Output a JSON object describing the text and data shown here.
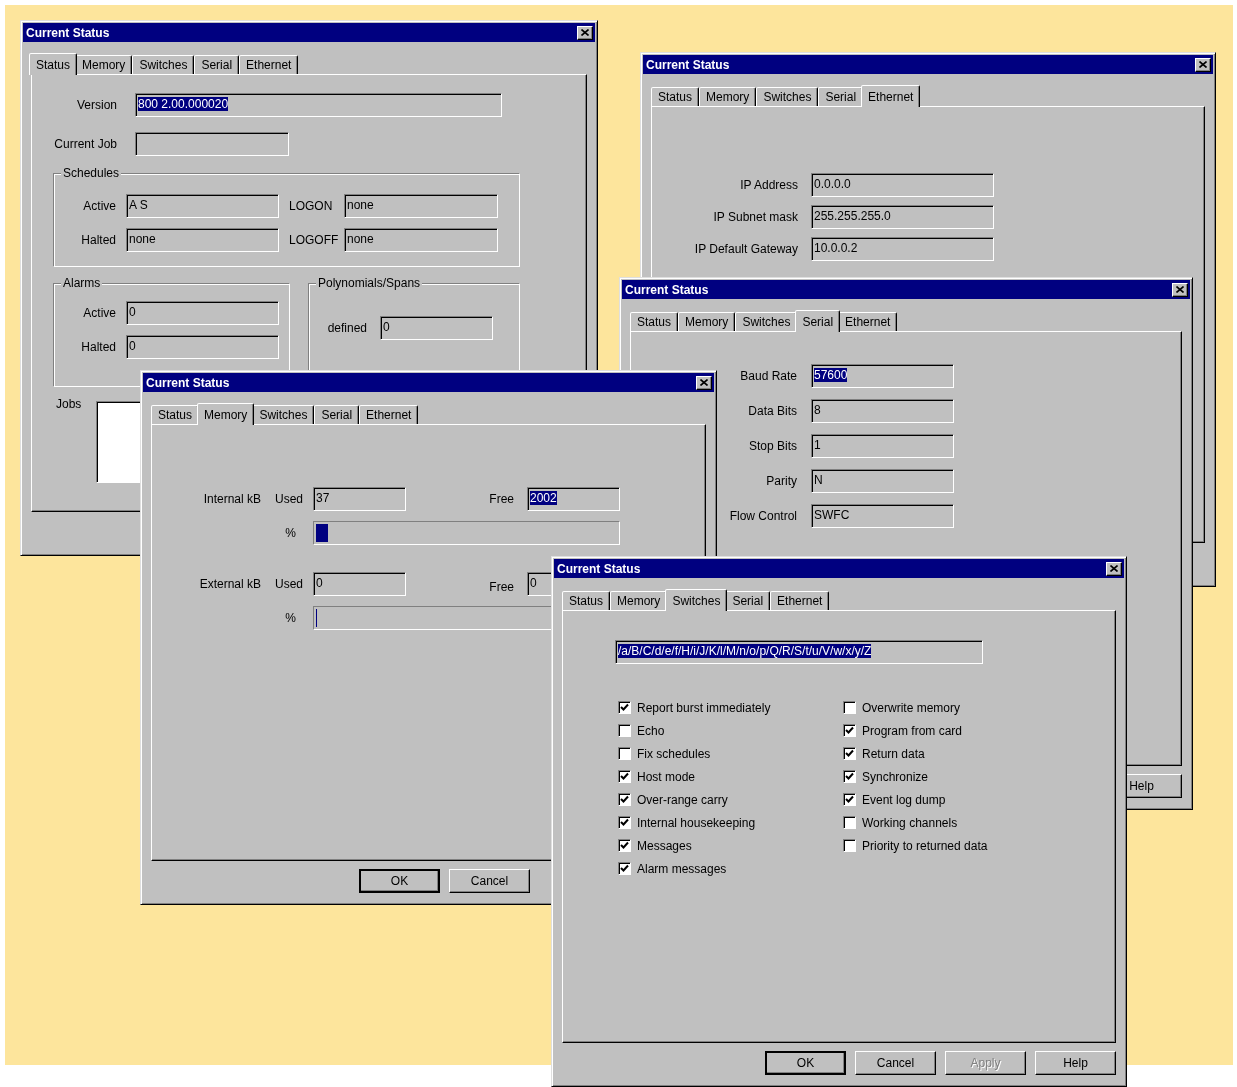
{
  "desktop": {
    "windows": [
      {
        "kind": "status",
        "title": "Current Status",
        "tabs": [
          {
            "label": "Status",
            "selected": true
          },
          {
            "label": "Memory",
            "selected": false
          },
          {
            "label": "Switches",
            "selected": false
          },
          {
            "label": "Serial",
            "selected": false
          },
          {
            "label": "Ethernet",
            "selected": false
          }
        ],
        "version": {
          "label": "Version",
          "value": "800 2.00.000020",
          "highlighted": true
        },
        "current_job": {
          "label": "Current Job"
        },
        "schedules": {
          "title": "Schedules",
          "fields": [
            {
              "label": "Active",
              "value": "A S",
              "highlighted": false
            },
            {
              "label": "LOGON",
              "value": "none",
              "highlighted": false
            },
            {
              "label": "Halted",
              "value": "none",
              "highlighted": false
            },
            {
              "label": "LOGOFF",
              "value": "none",
              "highlighted": false
            }
          ]
        },
        "alarms": {
          "title": "Alarms",
          "fields": [
            {
              "label": "Active",
              "value": "0",
              "highlighted": false
            },
            {
              "label": "Halted",
              "value": "0",
              "highlighted": false
            }
          ]
        },
        "polynomials": {
          "title": "Polynomials/Spans",
          "fields": [
            {
              "label": "defined",
              "value": "0",
              "highlighted": false
            }
          ]
        },
        "jobs": {
          "label": "Jobs"
        }
      },
      {
        "kind": "ethernet",
        "title": "Current Status",
        "tabs": [
          {
            "label": "Status",
            "selected": false
          },
          {
            "label": "Memory",
            "selected": false
          },
          {
            "label": "Switches",
            "selected": false
          },
          {
            "label": "Serial",
            "selected": false
          },
          {
            "label": "Ethernet",
            "selected": true
          }
        ],
        "fields": [
          {
            "label": "IP Address",
            "value": "0.0.0.0",
            "highlighted": false
          },
          {
            "label": "IP Subnet mask",
            "value": "255.255.255.0",
            "highlighted": false
          },
          {
            "label": "IP Default Gateway",
            "value": "10.0.0.2",
            "highlighted": false
          }
        ]
      },
      {
        "kind": "serial",
        "title": "Current Status",
        "tabs": [
          {
            "label": "Status",
            "selected": false
          },
          {
            "label": "Memory",
            "selected": false
          },
          {
            "label": "Switches",
            "selected": false
          },
          {
            "label": "Serial",
            "selected": true
          },
          {
            "label": "Ethernet",
            "selected": false
          }
        ],
        "fields": [
          {
            "label": "Baud Rate",
            "value": "57600",
            "highlighted": true
          },
          {
            "label": "Data Bits",
            "value": "8",
            "highlighted": false
          },
          {
            "label": "Stop Bits",
            "value": "1",
            "highlighted": false
          },
          {
            "label": "Parity",
            "value": "N",
            "highlighted": false
          },
          {
            "label": "Flow Control",
            "value": "SWFC",
            "highlighted": false
          }
        ],
        "buttons": [
          {
            "label": "Help",
            "disabled": false,
            "default": false
          }
        ]
      },
      {
        "kind": "memory",
        "title": "Current Status",
        "tabs": [
          {
            "label": "Status",
            "selected": false
          },
          {
            "label": "Memory",
            "selected": true
          },
          {
            "label": "Switches",
            "selected": false
          },
          {
            "label": "Serial",
            "selected": false
          },
          {
            "label": "Ethernet",
            "selected": false
          }
        ],
        "rows": [
          {
            "label": "Internal kB",
            "used_label": "Used",
            "used": {
              "value": "37",
              "highlighted": false
            },
            "free_label": "Free",
            "free": {
              "value": "2002",
              "highlighted": true
            },
            "percent_label": "%",
            "level": 0.04
          },
          {
            "label": "External kB",
            "used_label": "Used",
            "used": {
              "value": "0",
              "highlighted": false
            },
            "free_label": "Free",
            "free": {
              "value": "0",
              "highlighted": false
            },
            "percent_label": "%",
            "level": 0
          }
        ],
        "buttons": [
          {
            "label": "OK",
            "disabled": false,
            "default": true
          },
          {
            "label": "Cancel",
            "disabled": false,
            "default": false
          }
        ]
      },
      {
        "kind": "switches",
        "title": "Current Status",
        "tabs": [
          {
            "label": "Status",
            "selected": false
          },
          {
            "label": "Memory",
            "selected": false
          },
          {
            "label": "Switches",
            "selected": true
          },
          {
            "label": "Serial",
            "selected": false
          },
          {
            "label": "Ethernet",
            "selected": false
          }
        ],
        "switch_string": {
          "value": "/a/B/C/d/e/f/H/i/J/K/l/M/n/o/p/Q/R/S/t/u/V/w/x/y/Z",
          "highlighted": true
        },
        "option_columns": [
          {
            "options": [
              {
                "label": "Report burst immediately",
                "checked": true
              },
              {
                "label": "Echo",
                "checked": false
              },
              {
                "label": "Fix schedules",
                "checked": false
              },
              {
                "label": "Host mode",
                "checked": true
              },
              {
                "label": "Over-range carry",
                "checked": true
              },
              {
                "label": "Internal housekeeping",
                "checked": true
              },
              {
                "label": "Messages",
                "checked": true
              },
              {
                "label": "Alarm messages",
                "checked": true
              }
            ]
          },
          {
            "options": [
              {
                "label": "Overwrite memory",
                "checked": false
              },
              {
                "label": "Program from card",
                "checked": true
              },
              {
                "label": "Return data",
                "checked": true
              },
              {
                "label": "Synchronize",
                "checked": true
              },
              {
                "label": "Event log dump",
                "checked": true
              },
              {
                "label": "Working channels",
                "checked": false
              },
              {
                "label": "Priority to returned data",
                "checked": false
              }
            ]
          }
        ],
        "buttons": [
          {
            "label": "OK",
            "disabled": false,
            "default": true
          },
          {
            "label": "Cancel",
            "disabled": false,
            "default": false
          },
          {
            "label": "Apply",
            "disabled": true,
            "default": false
          },
          {
            "label": "Help",
            "disabled": false,
            "default": false
          }
        ]
      }
    ]
  }
}
